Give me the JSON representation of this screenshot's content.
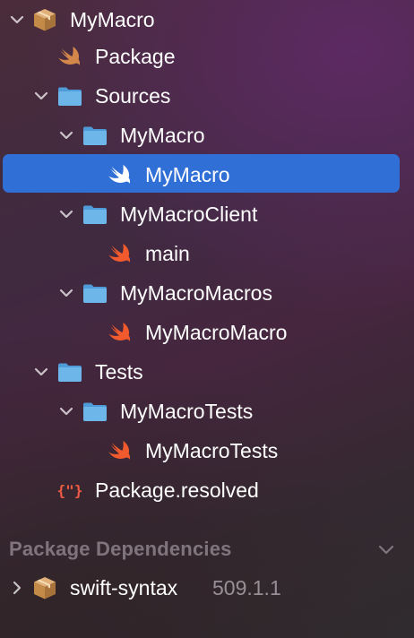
{
  "tree": {
    "root": {
      "label": "MyMacro",
      "icon": "package-icon"
    },
    "package_file": {
      "label": "Package",
      "icon": "swift-file-icon"
    },
    "sources_folder": {
      "label": "Sources",
      "icon": "folder-icon"
    },
    "mymacro_folder": {
      "label": "MyMacro",
      "icon": "folder-icon"
    },
    "mymacro_file": {
      "label": "MyMacro",
      "icon": "swift-file-icon",
      "selected": true
    },
    "client_folder": {
      "label": "MyMacroClient",
      "icon": "folder-icon"
    },
    "main_file": {
      "label": "main",
      "icon": "swift-file-icon"
    },
    "macros_folder": {
      "label": "MyMacroMacros",
      "icon": "folder-icon"
    },
    "macro_file": {
      "label": "MyMacroMacro",
      "icon": "swift-file-icon"
    },
    "tests_folder": {
      "label": "Tests",
      "icon": "folder-icon"
    },
    "tests_subfolder": {
      "label": "MyMacroTests",
      "icon": "folder-icon"
    },
    "tests_file": {
      "label": "MyMacroTests",
      "icon": "swift-file-icon"
    },
    "resolved_file": {
      "label": "Package.resolved",
      "icon": "json-file-icon"
    }
  },
  "dependencies": {
    "header": "Package Dependencies",
    "items": [
      {
        "label": "swift-syntax",
        "version": "509.1.1",
        "icon": "package-icon"
      }
    ]
  },
  "colors": {
    "selection": "#2f6fd6",
    "folder": "#5aa6e0",
    "swift": "#f05a2c",
    "package": "#c08a4a"
  }
}
